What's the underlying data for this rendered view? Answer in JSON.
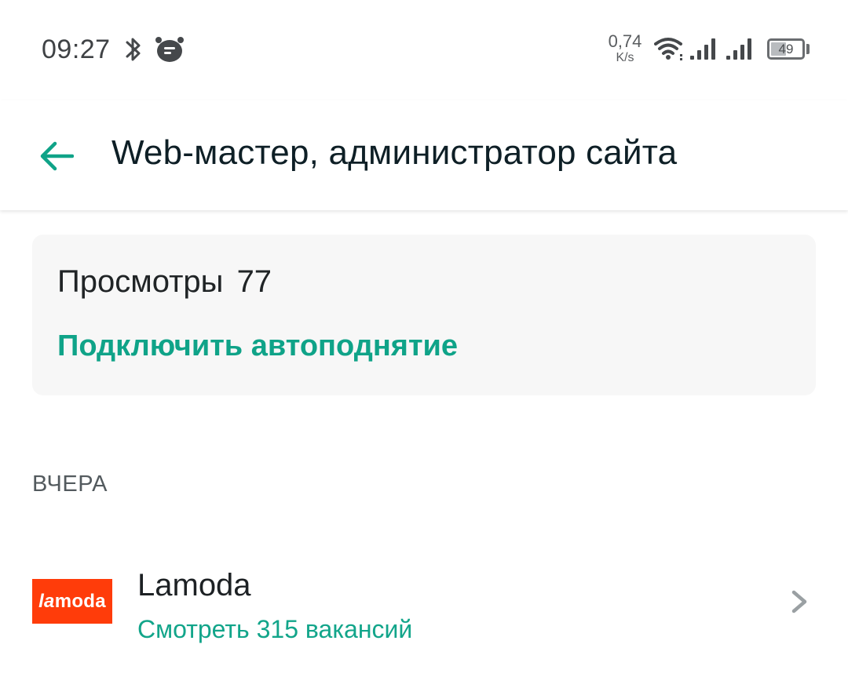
{
  "status_bar": {
    "time": "09:27",
    "net_speed_value": "0,74",
    "net_speed_unit": "K/s",
    "battery_level": "49",
    "icons": [
      "bluetooth-icon",
      "notification-app-icon",
      "wifi-icon",
      "cell-signal-icon",
      "cell-signal-icon",
      "battery-icon"
    ]
  },
  "app_bar": {
    "back_icon": "arrow-left-icon",
    "title": "Web-мастер, администратор сайта"
  },
  "stats_card": {
    "views_label": "Просмотры",
    "views_count": "77",
    "autoraise_link": "Подключить автоподнятие"
  },
  "section": {
    "header": "ВЧЕРА"
  },
  "company": {
    "logo_text_prefix": "la",
    "logo_text_suffix": "moda",
    "name": "Lamoda",
    "vacancies_link": "Смотреть 315 вакансий",
    "chevron_icon": "chevron-right-icon"
  },
  "colors": {
    "accent": "#0fa388",
    "brand_lamoda": "#ff3c0a",
    "title_text": "#0e1f26",
    "card_background": "#f7f7f7"
  }
}
